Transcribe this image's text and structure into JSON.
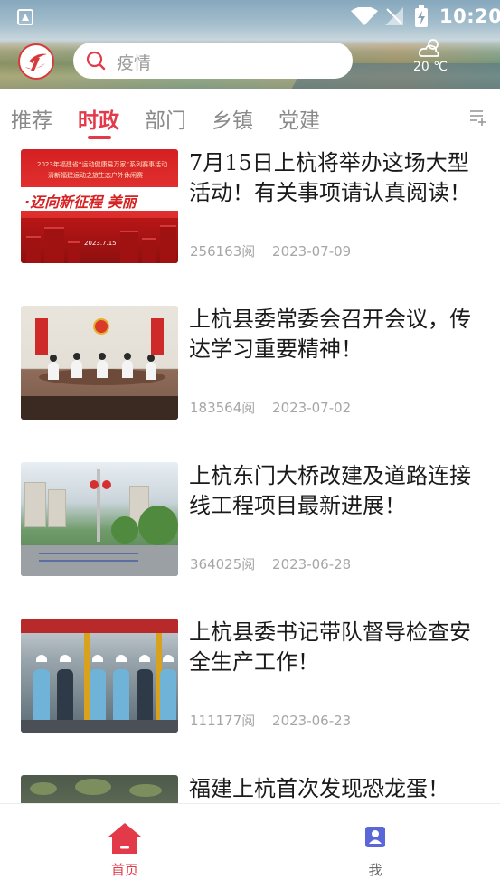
{
  "status_bar": {
    "time": "10:20"
  },
  "header": {
    "search_placeholder": "疫情",
    "weather_temp": "20 ℃"
  },
  "tabs": [
    {
      "label": "推荐",
      "active": false
    },
    {
      "label": "时政",
      "active": true
    },
    {
      "label": "部门",
      "active": false
    },
    {
      "label": "乡镇",
      "active": false
    },
    {
      "label": "党建",
      "active": false
    }
  ],
  "articles": [
    {
      "title": "7月15日上杭将举办这场大型活动！有关事项请认真阅读！",
      "reads": "256163阅",
      "date": "2023-07-09",
      "thumb_text": {
        "line1": "2023年福建省“运动健康易万家”系列赛事活动",
        "line2": "清新福建运动之旅生态户外休闲赛",
        "banner": "·迈向新征程 美丽",
        "place_date": "2023.7.15"
      }
    },
    {
      "title": "上杭县委常委会召开会议，传达学习重要精神！",
      "reads": "183564阅",
      "date": "2023-07-02"
    },
    {
      "title": "上杭东门大桥改建及道路连接线工程项目最新进展！",
      "reads": "364025阅",
      "date": "2023-06-28"
    },
    {
      "title": "上杭县委书记带队督导检查安全生产工作！",
      "reads": "111177阅",
      "date": "2023-06-23"
    },
    {
      "title": "福建上杭首次发现恐龙蛋！",
      "reads": "",
      "date": ""
    }
  ],
  "bottom_nav": {
    "home_label": "首页",
    "me_label": "我"
  },
  "colors": {
    "accent": "#e33a4a",
    "text_primary": "#1a1a1a",
    "text_meta": "#a6a6a6"
  }
}
